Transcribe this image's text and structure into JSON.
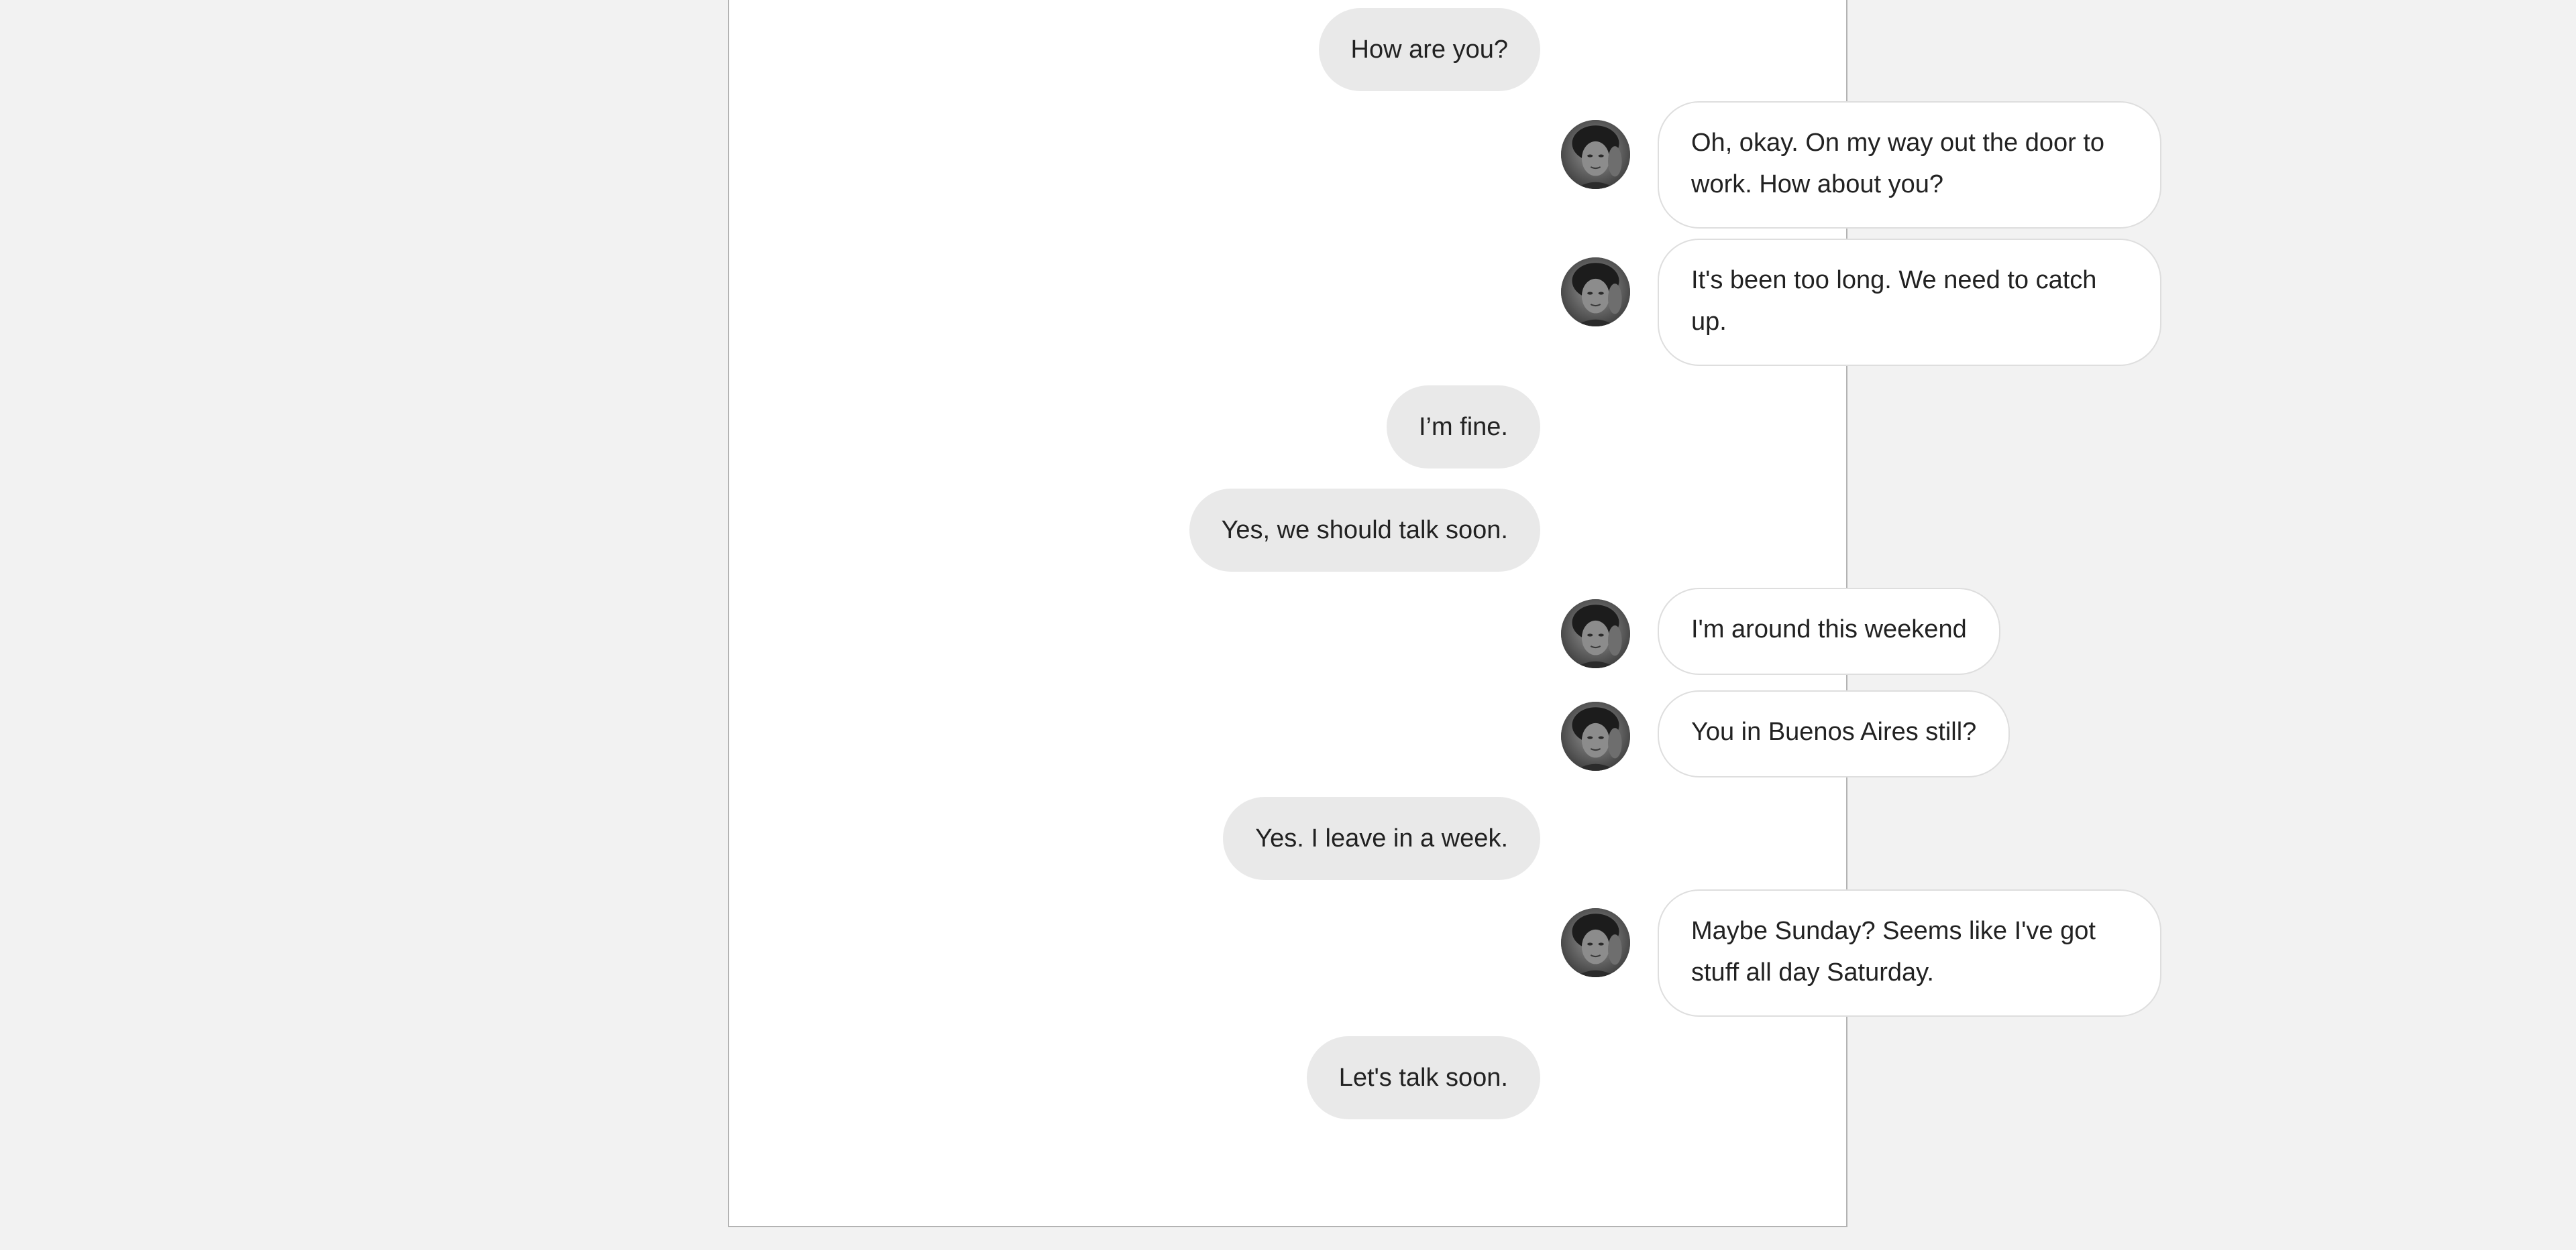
{
  "conversation": {
    "contact_avatar_icon": "contact-photo-avatar",
    "bubble_colors": {
      "outgoing_bg": "#e9e9e9",
      "incoming_bg": "#ffffff",
      "incoming_border": "#dedede",
      "text": "#222222"
    },
    "messages": [
      {
        "direction": "outgoing",
        "text": "How are you?"
      },
      {
        "direction": "incoming",
        "text": "Oh, okay. On my way out the door to work.  How about you?"
      },
      {
        "direction": "incoming",
        "text": "It's been too long. We need to catch up."
      },
      {
        "direction": "outgoing",
        "text": "I’m fine."
      },
      {
        "direction": "outgoing",
        "text": "Yes, we should talk soon."
      },
      {
        "direction": "incoming",
        "text": "I'm around this weekend"
      },
      {
        "direction": "incoming",
        "text": "You in Buenos Aires still?"
      },
      {
        "direction": "outgoing",
        "text": "Yes. I leave in a week."
      },
      {
        "direction": "incoming",
        "text": "Maybe Sunday?  Seems like I've got stuff all day Saturday."
      },
      {
        "direction": "outgoing",
        "text": "Let's talk soon."
      }
    ]
  }
}
